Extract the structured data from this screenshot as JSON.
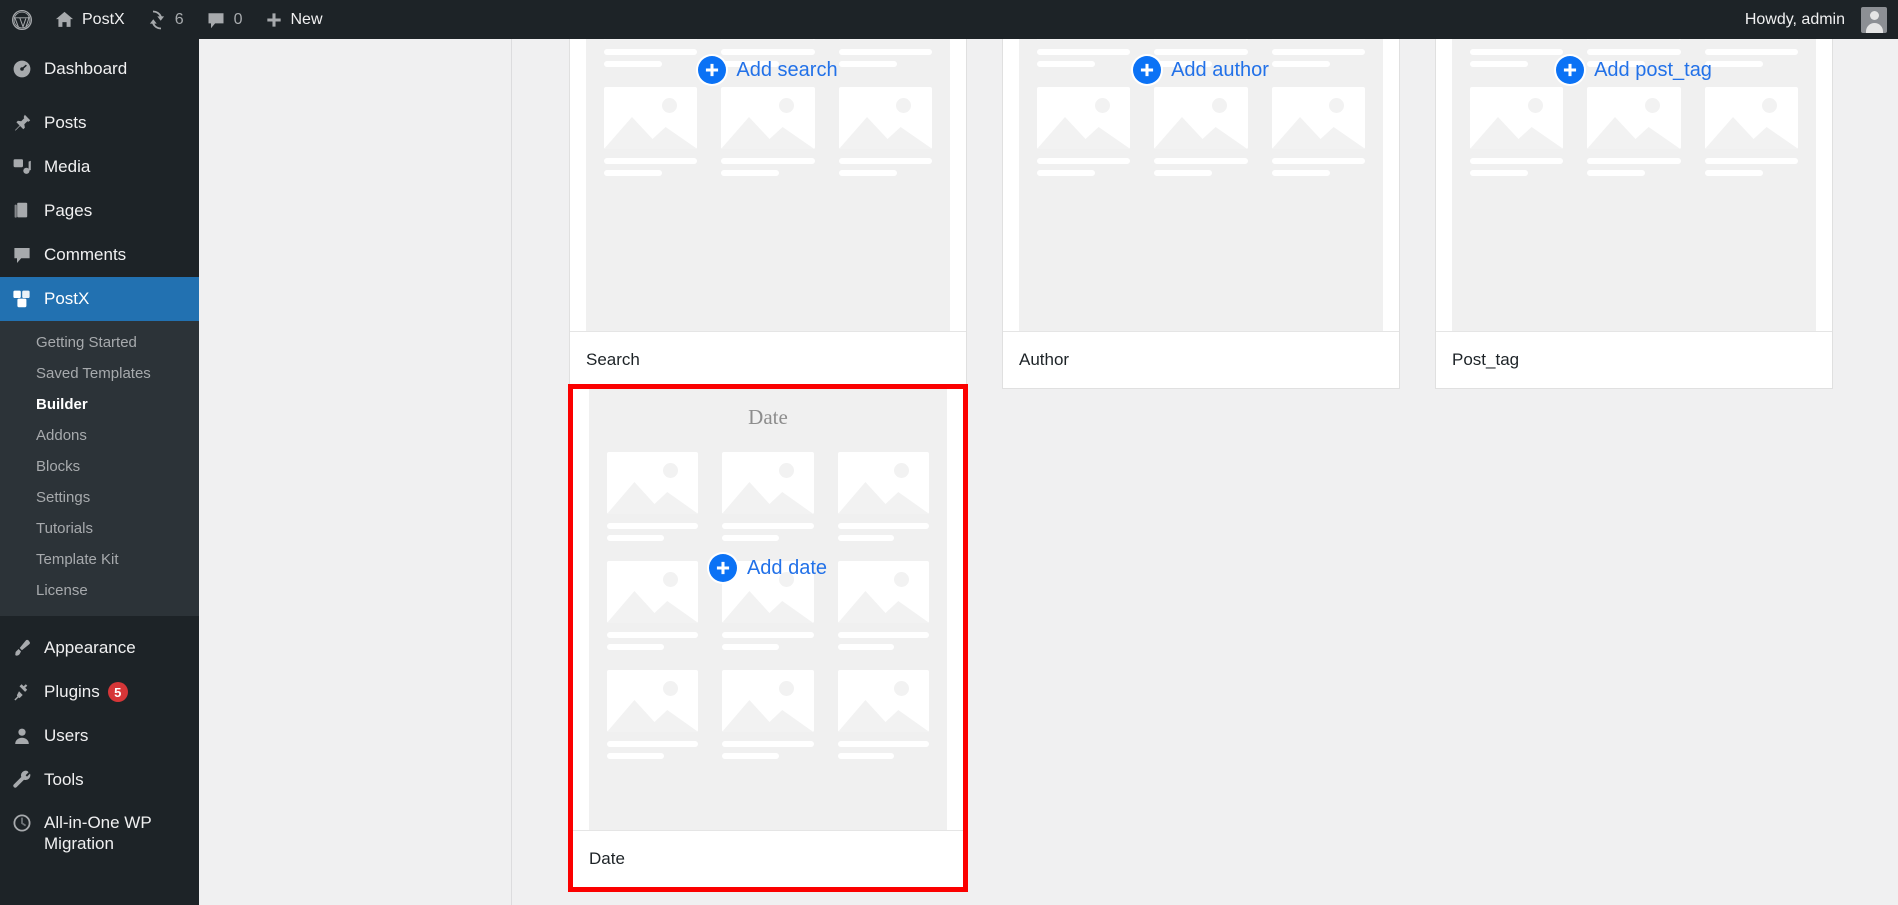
{
  "adminbar": {
    "wp_logo_icon": "wordpress-logo-icon",
    "site_home_icon": "home-icon",
    "site_name": "PostX",
    "updates_icon": "updates-icon",
    "updates_count": "6",
    "comments_icon": "comments-bubble-icon",
    "comments_count": "0",
    "new_icon": "plus-icon",
    "new_label": "New",
    "howdy": "Howdy, admin",
    "avatar_icon": "avatar-icon"
  },
  "sidebar": {
    "items": [
      {
        "label": "Dashboard",
        "icon": "dashboard-icon",
        "current": false
      },
      {
        "label": "Posts",
        "icon": "pin-icon",
        "current": false
      },
      {
        "label": "Media",
        "icon": "media-icon",
        "current": false
      },
      {
        "label": "Pages",
        "icon": "pages-icon",
        "current": false
      },
      {
        "label": "Comments",
        "icon": "comments-bubble-icon",
        "current": false
      },
      {
        "label": "PostX",
        "icon": "postx-blocks-icon",
        "current": true
      },
      {
        "label": "Appearance",
        "icon": "paintbrush-icon",
        "current": false
      },
      {
        "label": "Plugins",
        "icon": "plug-icon",
        "current": false,
        "badge": "5"
      },
      {
        "label": "Users",
        "icon": "user-icon",
        "current": false
      },
      {
        "label": "Tools",
        "icon": "wrench-icon",
        "current": false
      },
      {
        "label": "All-in-One WP Migration",
        "icon": "migration-icon",
        "current": false
      }
    ],
    "submenu": [
      {
        "label": "Getting Started",
        "current": false
      },
      {
        "label": "Saved Templates",
        "current": false
      },
      {
        "label": "Builder",
        "current": true
      },
      {
        "label": "Addons",
        "current": false
      },
      {
        "label": "Blocks",
        "current": false
      },
      {
        "label": "Settings",
        "current": false
      },
      {
        "label": "Tutorials",
        "current": false
      },
      {
        "label": "Template Kit",
        "current": false
      },
      {
        "label": "License",
        "current": false
      }
    ]
  },
  "builder": {
    "cards": [
      {
        "preview_title": "",
        "add_label": "Add search",
        "footer_label": "Search",
        "selected": false,
        "placeholder_rows": 2
      },
      {
        "preview_title": "",
        "add_label": "Add author",
        "footer_label": "Author",
        "selected": false,
        "placeholder_rows": 2
      },
      {
        "preview_title": "",
        "add_label": "Add post_tag",
        "footer_label": "Post_tag",
        "selected": false,
        "placeholder_rows": 2
      },
      {
        "preview_title": "Date",
        "add_label": "Add date",
        "footer_label": "Date",
        "selected": true,
        "placeholder_rows": 3
      }
    ]
  },
  "colors": {
    "admin_dark": "#1d2327",
    "admin_submenu": "#2c3338",
    "accent_blue": "#2271b1",
    "link_blue": "#2271e8",
    "plus_blue": "#0b72f5",
    "highlight_red": "#fb0000",
    "badge_red": "#d63638",
    "canvas_grey": "#f0f0f1"
  }
}
